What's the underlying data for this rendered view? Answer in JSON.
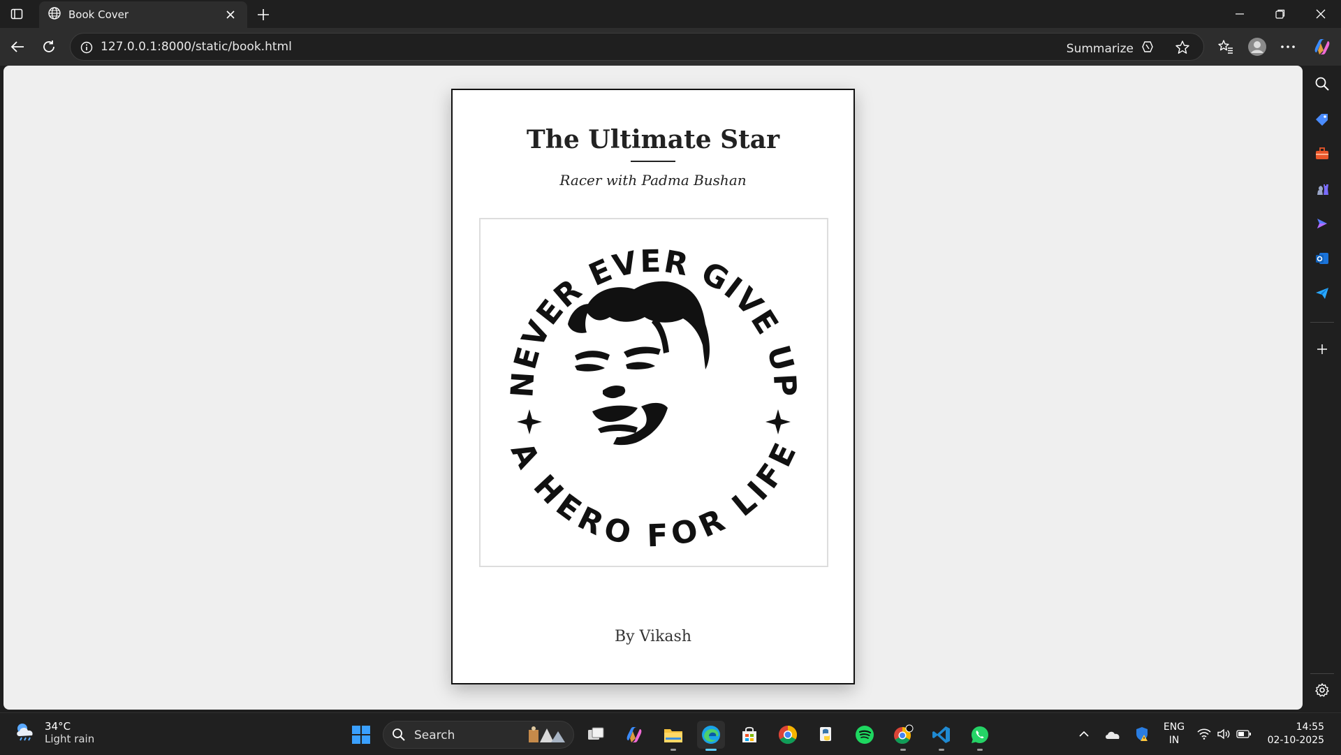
{
  "browser": {
    "tab": {
      "title": "Book Cover"
    },
    "address": {
      "url": "127.0.0.1:8000/static/book.html",
      "summarize_label": "Summarize"
    }
  },
  "book": {
    "title": "The Ultimate Star",
    "subtitle": "Racer with Padma Bushan",
    "artwork": {
      "top_text": "NEVER EVER GIVE UP",
      "bottom_text": "A HERO FOR LIFE"
    },
    "author": "By Vikash"
  },
  "sidebar": {
    "icons": [
      "search-icon",
      "tag-icon",
      "toolbox-icon",
      "chess-icon",
      "copilot-icon",
      "outlook-icon",
      "send-icon",
      "add-icon",
      "settings-icon"
    ]
  },
  "taskbar": {
    "weather": {
      "temp": "34°C",
      "condition": "Light rain"
    },
    "search_label": "Search",
    "apps": [
      "start",
      "search",
      "task-view",
      "copilot",
      "file-explorer",
      "edge",
      "store",
      "chrome",
      "python",
      "spotify",
      "chrome-profile",
      "vscode",
      "whatsapp"
    ],
    "tray": {
      "lang_top": "ENG",
      "lang_bottom": "IN",
      "time": "14:55",
      "date": "02-10-2025"
    }
  },
  "colors": {
    "accent": "#60cdff",
    "page_bg": "#efefef",
    "frame": "#1f1f1f",
    "toolbar": "#2d2d2d"
  }
}
